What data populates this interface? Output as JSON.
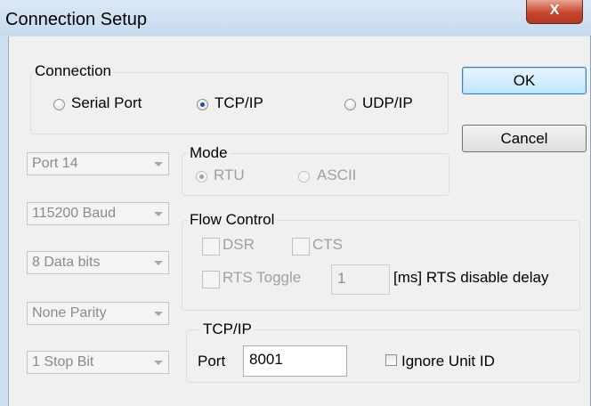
{
  "window": {
    "title": "Connection Setup",
    "close_glyph": "X"
  },
  "connection": {
    "group_label": "Connection",
    "options": [
      "Serial Port",
      "TCP/IP",
      "UDP/IP"
    ],
    "selected": "TCP/IP"
  },
  "buttons": {
    "ok": "OK",
    "cancel": "Cancel"
  },
  "serial_settings": {
    "port": "Port 14",
    "baud": "115200 Baud",
    "data_bits": "8 Data bits",
    "parity": "None Parity",
    "stop_bits": "1 Stop Bit"
  },
  "mode": {
    "group_label": "Mode",
    "options": [
      "RTU",
      "ASCII"
    ],
    "selected": "RTU"
  },
  "flow_control": {
    "group_label": "Flow Control",
    "dsr": "DSR",
    "cts": "CTS",
    "rts_toggle": "RTS Toggle",
    "rts_delay_value": "1",
    "rts_delay_label": "[ms] RTS disable delay"
  },
  "tcpip": {
    "group_label": "TCP/IP",
    "port_label": "Port",
    "port_value": "8001",
    "ignore_unit_id": "Ignore Unit ID"
  }
}
